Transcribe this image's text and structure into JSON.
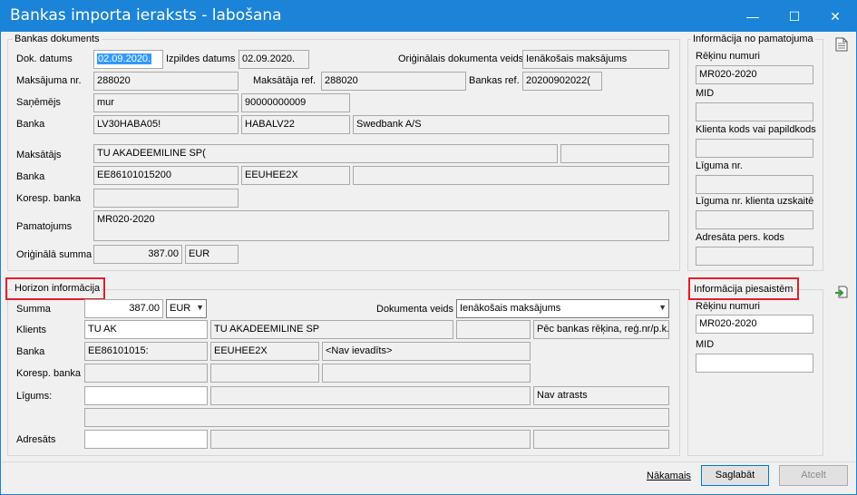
{
  "window": {
    "title": "Bankas importa ieraksts - labošana",
    "minimize": "—",
    "maximize": "☐",
    "close": "✕"
  },
  "bank_doc": {
    "section_title": "Bankas dokuments",
    "dok_datums_label": "Dok. datums",
    "dok_datums_value": "02.09.2020.",
    "izpildes_label": "Izpildes datums",
    "izpildes_value": "02.09.2020.",
    "orig_dok_veids_label": "Oriģinālais dokumenta veids",
    "orig_dok_veids_value": "Ienākošais maksājums",
    "maks_nr_label": "Maksājuma nr.",
    "maks_nr_value": "288020",
    "maksataja_ref_label": "Maksātāja ref.",
    "maksataja_ref_value": "288020",
    "bankas_ref_label": "Bankas ref.",
    "bankas_ref_value": "20200902022(",
    "sanemejs_label": "Saņēmējs",
    "sanemejs_name": "mur",
    "sanemejs_code": "90000000009",
    "banka_label": "Banka",
    "banka_iban": "LV30HABA05!",
    "banka_bic": "HABALV22",
    "banka_name": "Swedbank A/S",
    "maksatajs_label": "Maksātājs",
    "maksatajs_value": "TU AKADEEMILINE SP(",
    "maksatajs_extra": "",
    "banka2_label": "Banka",
    "banka2_iban": "EE86101015200",
    "banka2_bic": "EEUHEE2X",
    "banka2_name": "",
    "koresp_label": "Koresp. banka",
    "koresp_value": "",
    "pamatojums_label": "Pamatojums",
    "pamatojums_value": "MR020-2020",
    "orig_summa_label": "Oriģinālā summa",
    "orig_summa_value": "387.00",
    "orig_summa_currency": "EUR"
  },
  "pamatojums_info": {
    "section_title": "Informācija no pamatojuma",
    "rekinu_label": "Rēķinu numuri",
    "rekinu_value": "MR020-2020",
    "mid_label": "MID",
    "mid_value": "",
    "klienta_kods_label": "Klienta kods vai papildkods",
    "klienta_kods_value": "",
    "liguma_label": "Līguma nr.",
    "liguma_value": "",
    "liguma_klienta_label": "Līguma nr. klienta uzskaitē",
    "liguma_klienta_value": "",
    "adresata_label": "Adresāta pers. kods",
    "adresata_value": ""
  },
  "horizon": {
    "section_title": "Horizon informācija",
    "summa_label": "Summa",
    "summa_value": "387.00",
    "currency": "EUR",
    "dok_veids_label": "Dokumenta veids",
    "dok_veids_value": "Ienākošais maksājums",
    "klients_label": "Klients",
    "klients_code": "TU AK",
    "klients_name": "TU AKADEEMILINE SP",
    "klients_mid": "",
    "klients_method": "Pēc bankas rēķina, reģ.nr/p.k.",
    "banka_label": "Banka",
    "banka_iban": "EE86101015:",
    "banka_bic": "EEUHEE2X",
    "banka_name": "<Nav ievadīts>",
    "koresp_label": "Koresp. banka",
    "ligums_label": "Līgums:",
    "ligums_status": "Nav atrasts",
    "adresats_label": "Adresāts"
  },
  "piesaistem": {
    "section_title": "Informācija piesaistēm",
    "rekinu_label": "Rēķinu numuri",
    "rekinu_value": "MR020-2020",
    "mid_label": "MID",
    "mid_value": ""
  },
  "footer": {
    "next_label": "Nākamais",
    "save_label": "Saglabāt",
    "cancel_label": "Atcelt"
  },
  "colors": {
    "titlebar": "#1b84d8",
    "highlight_box": "#e0202a",
    "selection": "#3399ff"
  }
}
